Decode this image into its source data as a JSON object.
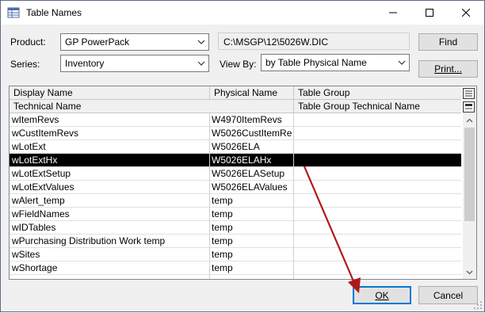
{
  "window": {
    "title": "Table Names"
  },
  "form": {
    "product_label": "Product:",
    "product_value": "GP PowerPack",
    "series_label": "Series:",
    "series_value": "Inventory",
    "path_value": "C:\\MSGP\\12\\5026W.DIC",
    "viewby_label": "View By:",
    "viewby_value": "by Table Physical Name"
  },
  "buttons": {
    "find": "Find",
    "print": "Print...",
    "ok": "OK",
    "cancel": "Cancel"
  },
  "grid": {
    "header1": [
      "Display Name",
      "Physical Name",
      "Table Group"
    ],
    "header2": [
      "Technical Name",
      "Table Group Technical Name"
    ],
    "rows": [
      [
        "wItemRevs",
        "W4970ItemRevs",
        ""
      ],
      [
        "wCustItemRevs",
        "W5026CustItemRe",
        ""
      ],
      [
        "wLotExt",
        "W5026ELA",
        ""
      ],
      [
        "wLotExtHx",
        "W5026ELAHx",
        ""
      ],
      [
        "wLotExtSetup",
        "W5026ELASetup",
        ""
      ],
      [
        "wLotExtValues",
        "W5026ELAValues",
        ""
      ],
      [
        "wAlert_temp",
        "temp",
        ""
      ],
      [
        "wFieldNames",
        "temp",
        ""
      ],
      [
        "wIDTables",
        "temp",
        ""
      ],
      [
        "wPurchasing Distribution Work temp",
        "temp",
        ""
      ],
      [
        "wSites",
        "temp",
        ""
      ],
      [
        "wShortage",
        "temp",
        ""
      ]
    ],
    "selected_index": 3
  },
  "icons": {
    "app": "table-window-icon",
    "minimize": "minimize-icon",
    "maximize": "maximize-icon",
    "close": "close-icon"
  },
  "colors": {
    "selection": "#000000",
    "annotation_arrow": "#b01818",
    "default_button_border": "#0078d7"
  }
}
